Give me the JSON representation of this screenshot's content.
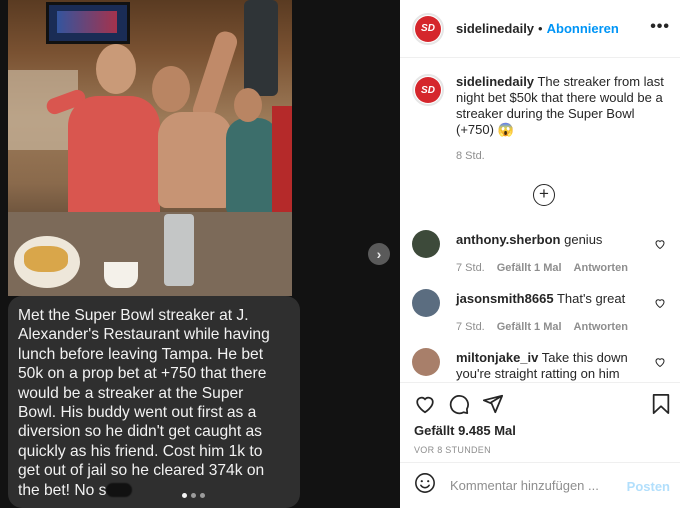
{
  "media": {
    "caption_lines": [
      "Met the Super Bowl streaker at J.",
      "Alexander's Restaurant while having",
      "lunch before leaving Tampa. He bet",
      "50k on a prop bet at +750 that there",
      "would be a streaker at the Super",
      "Bowl. His buddy went out first as a",
      "diversion so he didn't get caught as",
      "quickly as his friend. Cost him 1k to",
      "get out of jail so he cleared 374k on",
      "the bet! No s"
    ],
    "next_icon": "chevron-right-icon",
    "carousel": {
      "count": 3,
      "active": 0
    }
  },
  "header": {
    "avatar_text": "SD",
    "username": "sidelinedaily",
    "separator": "•",
    "follow_label": "Abonnieren",
    "more_icon": "•••"
  },
  "post": {
    "username": "sidelinedaily",
    "caption": "The streaker from last night bet $50k that there would be a streaker during the Super Bowl (+750) 😱",
    "time": "8 Std."
  },
  "load_more_icon": "+",
  "comments": [
    {
      "username": "anthony.sherbon",
      "text": "genius",
      "time": "7 Std.",
      "likes": "Gefällt 1 Mal",
      "reply": "Antworten",
      "avatar_color": "#3d4a3a"
    },
    {
      "username": "jasonsmith8665",
      "text": "That's great",
      "time": "7 Std.",
      "likes": "Gefällt 1 Mal",
      "reply": "Antworten",
      "avatar_color": "#5b6d80"
    },
    {
      "username": "miltonjake_iv",
      "text": "Take this down you're straight ratting on him",
      "time": "",
      "likes": "",
      "reply": "",
      "avatar_color": "#a87f6a"
    }
  ],
  "actions": {
    "like_icon": "heart-icon",
    "comment_icon": "comment-icon",
    "share_icon": "share-icon",
    "save_icon": "bookmark-icon",
    "likes_label": "Gefällt 9.485 Mal",
    "date_label": "VOR 8 STUNDEN"
  },
  "comment_input": {
    "placeholder": "Kommentar hinzufügen ...",
    "post_label": "Posten"
  },
  "colors": {
    "accent": "#0095f6",
    "brand_red": "#d5262c",
    "muted": "#8e8e8e",
    "post_disabled": "#b2dffc"
  }
}
